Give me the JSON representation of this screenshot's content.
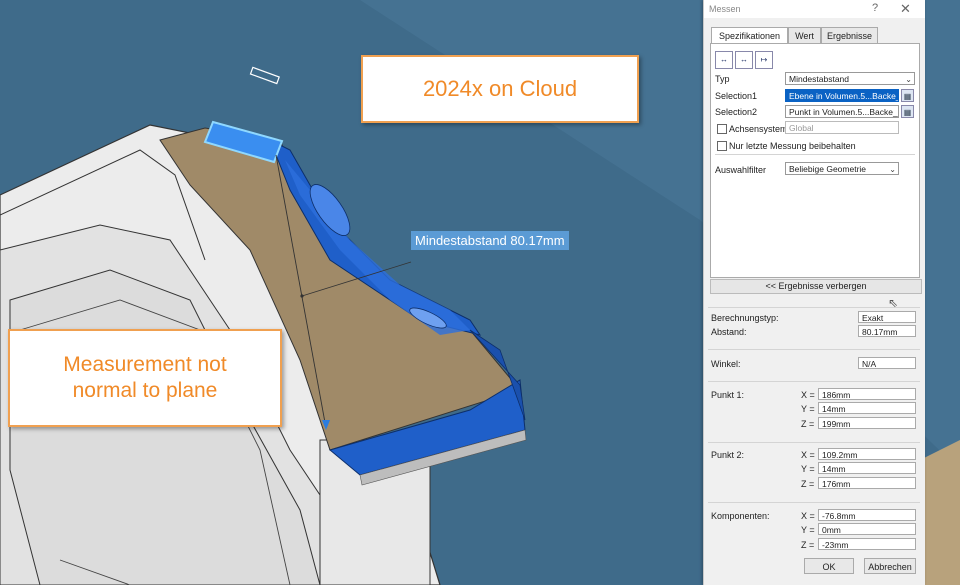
{
  "annotations": {
    "cloud_label": "2024x on Cloud",
    "normal_label": "Measurement not normal to plane",
    "measure_label": "Mindestabstand 80.17mm"
  },
  "dialog": {
    "title": "Messen",
    "help": "?",
    "close": "✕",
    "tabs": [
      {
        "label": "Spezifikationen"
      },
      {
        "label": "Wert"
      },
      {
        "label": "Ergebnisse"
      }
    ],
    "mode_buttons": [
      "↔",
      "↔",
      "↦"
    ],
    "typ_label": "Typ",
    "typ_value": "Mindestabstand",
    "selection1_label": "Selection1",
    "selection1_value": "Ebene in Volumen.5...Backe_",
    "selection2_label": "Selection2",
    "selection2_value": "Punkt in Volumen.5...Backe_",
    "achsensystem_label": "Achsensystem",
    "achsensystem_value": "Global",
    "keep_last_label": "Nur letzte Messung beibehalten",
    "filter_label": "Auswahlfilter",
    "filter_value": "Beliebige Geometrie",
    "toggle_results_label": "<< Ergebnisse verbergen",
    "results": {
      "calc_type_label": "Berechnungstyp:",
      "calc_type_value": "Exakt",
      "distance_label": "Abstand:",
      "distance_value": "80.17mm",
      "angle_label": "Winkel:",
      "angle_value": "N/A",
      "axes": [
        "X =",
        "Y =",
        "Z ="
      ],
      "punkt1_label": "Punkt 1:",
      "punkt1": {
        "x": "186mm",
        "y": "14mm",
        "z": "199mm"
      },
      "punkt2_label": "Punkt 2:",
      "punkt2": {
        "x": "109.2mm",
        "y": "14mm",
        "z": "176mm"
      },
      "components_label": "Komponenten:",
      "components": {
        "x": "-76.8mm",
        "y": "0mm",
        "z": "-23mm"
      }
    },
    "ok_label": "OK",
    "cancel_label": "Abbrechen"
  },
  "colors": {
    "background": "#3f6b8a",
    "accent_orange": "#f08a28",
    "measure_label_bg": "#5b9bd5",
    "selection_blue": "#0a62c4",
    "part_tan": "#a08a68",
    "part_blue": "#1f5fc9"
  }
}
